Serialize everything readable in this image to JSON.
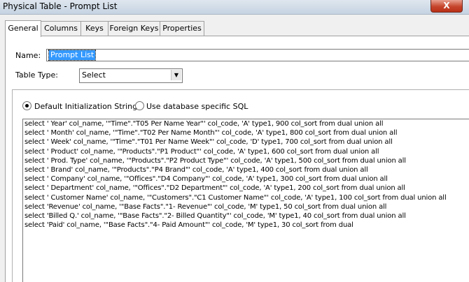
{
  "window": {
    "title": "Physical Table - Prompt List",
    "close_glyph": "X"
  },
  "tabs": [
    {
      "label": "General",
      "active": true
    },
    {
      "label": "Columns",
      "active": false
    },
    {
      "label": "Keys",
      "active": false
    },
    {
      "label": "Foreign Keys",
      "active": false
    },
    {
      "label": "Properties",
      "active": false
    }
  ],
  "general": {
    "name_label": "Name:",
    "name_value": "Prompt List",
    "table_type_label": "Table Type:",
    "table_type_value": "Select",
    "radio_default_label": "Default Initialization String",
    "radio_specific_label": "Use database specific SQL",
    "selected_radio": "default",
    "sql_lines": [
      "select ' Year' col_name, '\"Time\".\"T05 Per Name Year\"' col_code, 'A' type1, 900 col_sort from dual union all",
      "select ' Month' col_name, '\"Time\".\"T02 Per Name Month\"' col_code, 'A' type1, 800 col_sort from dual union all",
      "select ' Week' col_name, '\"Time\".\"T01 Per Name Week\"' col_code, 'D' type1, 700 col_sort from dual union all",
      "select ' Product' col_name, '\"Products\".\"P1 Product\"' col_code, 'A' type1, 600 col_sort from dual union all",
      "select ' Prod. Type' col_name, '\"Products\".\"P2 Product Type\"' col_code, 'A' type1, 500 col_sort from dual union all",
      "select ' Brand' col_name, '\"Products\".\"P4 Brand\"' col_code, 'A' type1, 400 col_sort from dual union all",
      "select ' Company' col_name, '\"Offices\".\"D4 Company\"' col_code, 'A' type1, 300 col_sort from dual union all",
      "select ' Department' col_name, '\"Offices\".\"D2 Department\"' col_code, 'A' type1, 200 col_sort from dual union all",
      "select ' Customer Name' col_name, '\"Customers\".\"C1 Customer Name\"' col_code, 'A' type1, 100 col_sort from dual union all",
      "select 'Revenue' col_name, '\"Base Facts\".\"1- Revenue\"' col_code, 'M' type1, 50 col_sort from dual union all",
      "select 'Billed Q.' col_name, '\"Base Facts\".\"2- Billed Quantity\"' col_code, 'M' type1, 40 col_sort from dual union all",
      "select 'Paid' col_name, '\"Base Facts\".\"4- Paid Amount\"' col_code, 'M' type1, 30 col_sort from dual"
    ]
  }
}
